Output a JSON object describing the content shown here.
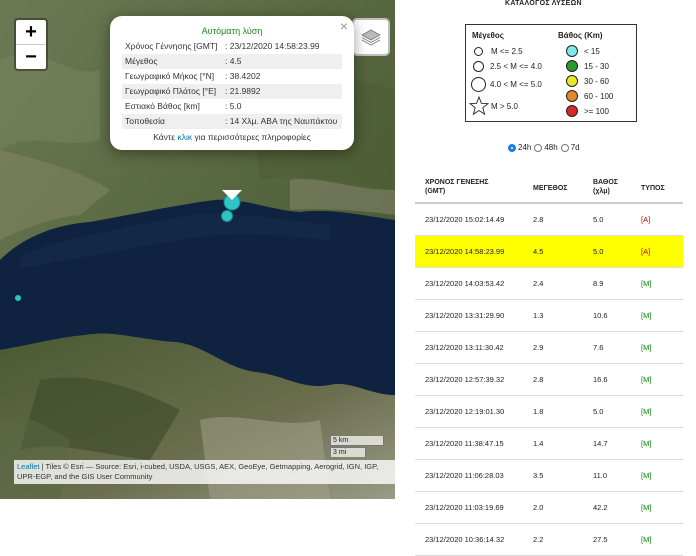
{
  "map": {
    "zoom_in": "+",
    "zoom_out": "−",
    "layers_icon": "layers-icon",
    "popup": {
      "close": "×",
      "title": "Αυτόματη λύση",
      "rows": [
        {
          "key": "Χρόνος Γέννησης [GMT]",
          "value": ": 23/12/2020 14:58:23.99"
        },
        {
          "key": "Μέγεθος",
          "value": ": 4.5"
        },
        {
          "key": "Γεωγραφικό Μήκος [°N]",
          "value": ": 38.4202"
        },
        {
          "key": "Γεωγραφικό Πλάτος [°E]",
          "value": ": 21.9892"
        },
        {
          "key": "Εστιακό Βάθος [km]",
          "value": ": 5.0"
        },
        {
          "key": "Τοποθεσία",
          "value": ": 14 Χλμ. ΑΒΑ της Ναυπάκτου"
        }
      ],
      "more_prefix": "Κάντε ",
      "more_link": "κλικ",
      "more_suffix": " για περισσότερες πληροφορίες"
    },
    "scale_km": "5 km",
    "scale_mi": "3 mi",
    "attribution_link": "Leaflet",
    "attribution_text": " | Tiles © Esri — Source: Esri, i-cubed, USDA, USGS, AEX, GeoEye, Getmapping, Aerogrid, IGN, IGP, UPR-EGP, and the GIS User Community",
    "marker_color": "#2ec4c4"
  },
  "panel": {
    "title": "ΚΑΤΑΛΟΓΟΣ ΛΥΣΕΩΝ",
    "legend": {
      "mag_header": "Μέγεθος",
      "depth_header": "Βάθος (Km)",
      "mag": [
        "M <= 2.5",
        "2.5 < M <= 4.0",
        "4.0 < M <= 5.0",
        "M > 5.0"
      ],
      "depth": [
        {
          "label": "< 15",
          "color": "#7fe8e8"
        },
        {
          "label": "15 - 30",
          "color": "#2a9a2a"
        },
        {
          "label": "30 - 60",
          "color": "#e8e82a"
        },
        {
          "label": "60 - 100",
          "color": "#e8862a"
        },
        {
          "label": ">= 100",
          "color": "#d42a2a"
        }
      ]
    },
    "period": {
      "opt1": "24h",
      "opt2": "48h",
      "opt3": "7d",
      "selected": "24h"
    },
    "headers": {
      "time_l1": "ΧΡΟΝΟΣ ΓΕΝΕΣΗΣ",
      "time_l2": "(GMT)",
      "mag": "ΜΕΓΕΘΟΣ",
      "depth_l1": "ΒΑΘΟΣ",
      "depth_l2": "(χλμ)",
      "type": "ΤΥΠΟΣ"
    },
    "rows": [
      {
        "time": "23/12/2020 15:02:14.49",
        "mag": "2.8",
        "depth": "5.0",
        "type": "[A]"
      },
      {
        "time": "23/12/2020 14:58:23.99",
        "mag": "4.5",
        "depth": "5.0",
        "type": "[A]"
      },
      {
        "time": "23/12/2020 14:03:53.42",
        "mag": "2.4",
        "depth": "8.9",
        "type": "[M]"
      },
      {
        "time": "23/12/2020 13:31:29.90",
        "mag": "1.3",
        "depth": "10.6",
        "type": "[M]"
      },
      {
        "time": "23/12/2020 13:11:30.42",
        "mag": "2.9",
        "depth": "7.6",
        "type": "[M]"
      },
      {
        "time": "23/12/2020 12:57:39.32",
        "mag": "2.8",
        "depth": "16.6",
        "type": "[M]"
      },
      {
        "time": "23/12/2020 12:19:01.30",
        "mag": "1.8",
        "depth": "5.0",
        "type": "[M]"
      },
      {
        "time": "23/12/2020 11:38:47.15",
        "mag": "1.4",
        "depth": "14.7",
        "type": "[M]"
      },
      {
        "time": "23/12/2020 11:06:28.03",
        "mag": "3.5",
        "depth": "11.0",
        "type": "[M]"
      },
      {
        "time": "23/12/2020 11:03:19.69",
        "mag": "2.0",
        "depth": "42.2",
        "type": "[M]"
      },
      {
        "time": "23/12/2020 10:36:14.32",
        "mag": "2.2",
        "depth": "27.5",
        "type": "[M]"
      }
    ],
    "selected_row": 1,
    "highlight_color": "#ffff00"
  }
}
